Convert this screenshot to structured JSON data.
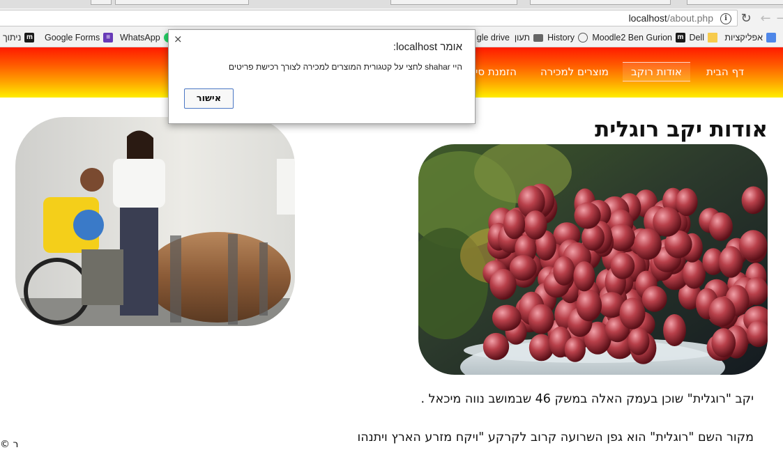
{
  "browser": {
    "url_host": "localhost",
    "url_path": "/about.php",
    "bookmarks": [
      {
        "label": "אפליקציות",
        "icon": "apps-grid-icon"
      },
      {
        "label": "Dell",
        "icon": "folder-icon"
      },
      {
        "label": "Moodle2 Ben Gurion",
        "icon": "moodle-icon"
      },
      {
        "label": "History",
        "icon": "history-icon"
      },
      {
        "label": "תעון",
        "icon": "camera-icon"
      },
      {
        "label": "gle drive",
        "icon": "google-drive-icon"
      },
      {
        "label": "WhatsApp",
        "icon": "whatsapp-icon"
      },
      {
        "label": "Google Forms",
        "icon": "google-forms-icon"
      },
      {
        "label": "ניתוך",
        "icon": "moodle-icon"
      }
    ]
  },
  "site_nav": {
    "items": [
      {
        "label": "דף הבית"
      },
      {
        "label": "אודות רוקב"
      },
      {
        "label": "מוצרים למכירה"
      },
      {
        "label": "הזמנת סי"
      }
    ],
    "active_index": 1
  },
  "main": {
    "title": "אודות יקב רוגלית",
    "paragraphs": [
      "יקב \"רוגלית\" שוכן בעמק האלה במשק 46 שבמושב נווה מיכאל .",
      "מקור השם \"רוגלית\" הוא גפן השרועה קרוב לקרקע \"ויקח מזרע הארץ ויתנהו"
    ],
    "footer": "© ר"
  },
  "dialog": {
    "title": "אומר localhost:",
    "message": "היי shahar לחצי על קטגורית המוצרים למכירה לצורך רכישת פריטים",
    "ok_label": "אישור",
    "close_symbol": "×"
  },
  "colors": {
    "nav_gradient_top": "#ff1a00",
    "nav_gradient_bottom": "#ffee00",
    "dialog_button_border": "#4a76c4"
  }
}
